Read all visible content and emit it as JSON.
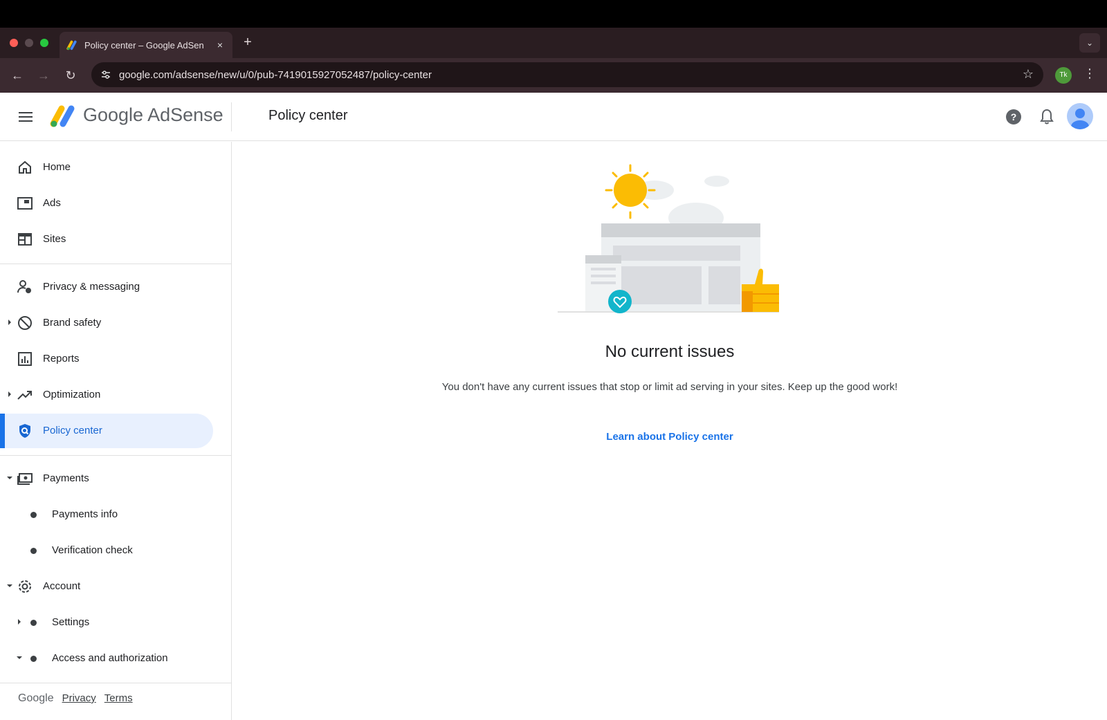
{
  "browser": {
    "tab_title": "Policy center – Google AdSen",
    "tab_close": "×",
    "new_tab": "+",
    "url": "google.com/adsense/new/u/0/pub-7419015927052487/policy-center",
    "profile_initials": "Tk",
    "colors": {
      "traffic_red": "#ff5f57",
      "traffic_yellow": "#5a4a4f",
      "traffic_green": "#28c840"
    }
  },
  "header": {
    "logo_text": "Google AdSense",
    "page_title": "Policy center"
  },
  "sidebar": {
    "items": [
      {
        "label": "Home",
        "icon": "home-icon"
      },
      {
        "label": "Ads",
        "icon": "ads-icon"
      },
      {
        "label": "Sites",
        "icon": "sites-icon"
      },
      {
        "label": "Privacy & messaging",
        "icon": "privacy-icon"
      },
      {
        "label": "Brand safety",
        "icon": "block-icon"
      },
      {
        "label": "Reports",
        "icon": "bar-chart-icon"
      },
      {
        "label": "Optimization",
        "icon": "trending-up-icon"
      },
      {
        "label": "Policy center",
        "icon": "policy-shield-icon",
        "active": true
      },
      {
        "label": "Payments",
        "icon": "payments-icon"
      },
      {
        "label": "Account",
        "icon": "gear-icon"
      }
    ],
    "sub_items": {
      "payments_info": "Payments info",
      "verification_check": "Verification check",
      "settings": "Settings",
      "access": "Access and authorization"
    },
    "footer": {
      "brand": "Google",
      "privacy": "Privacy",
      "terms": "Terms"
    }
  },
  "main": {
    "title": "No current issues",
    "description": "You don't have any current issues that stop or limit ad serving in your sites. Keep up the good work!",
    "link": "Learn about Policy center"
  }
}
